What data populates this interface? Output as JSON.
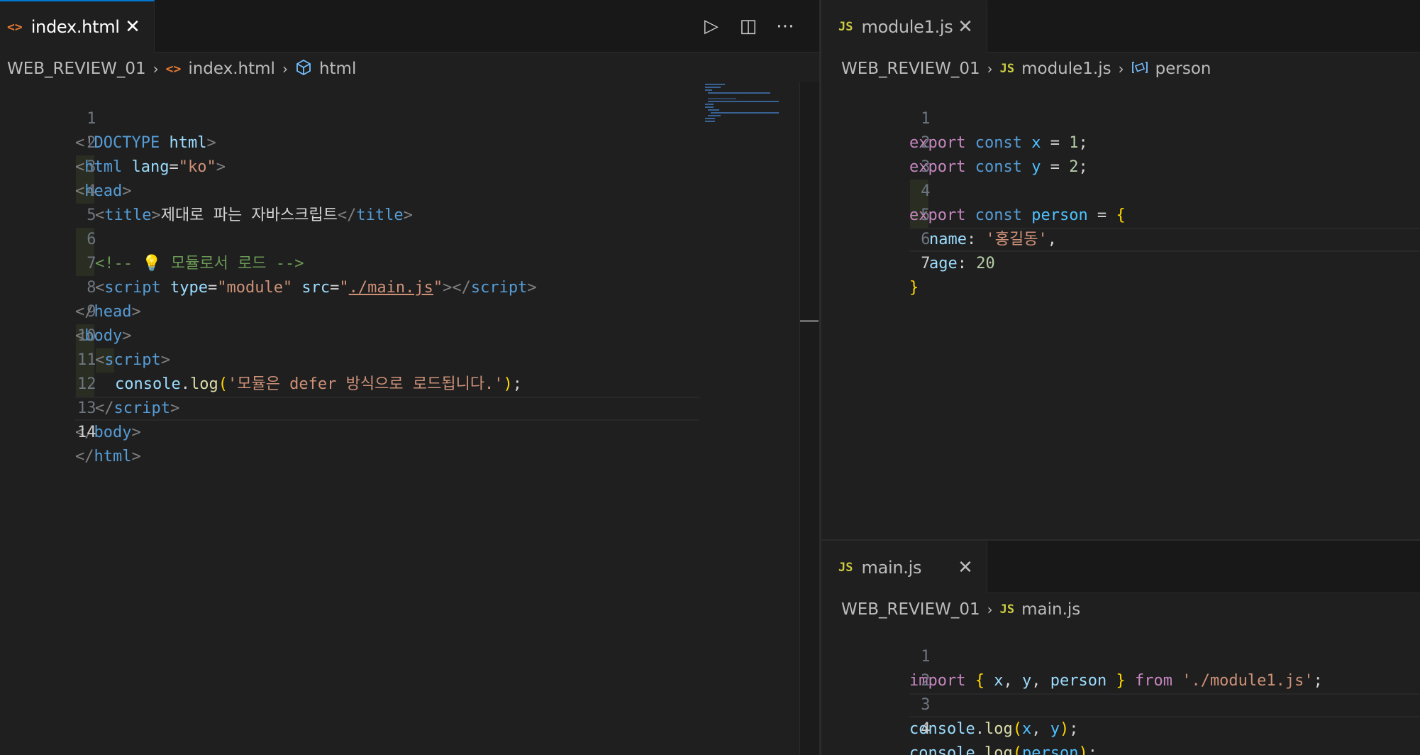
{
  "left_pane": {
    "tab": {
      "label": "index.html",
      "close": "✕",
      "icon": "html-file-icon"
    },
    "actions": {
      "run": "▷",
      "split": "◫",
      "more": "⋯"
    },
    "breadcrumb": {
      "root": "WEB_REVIEW_01",
      "file": "index.html",
      "symbol": "html",
      "sep": "›"
    },
    "line_numbers": [
      "1",
      "2",
      "3",
      "4",
      "5",
      "6",
      "7",
      "8",
      "9",
      "10",
      "11",
      "12",
      "13",
      "14"
    ],
    "code": {
      "l1": {
        "a": "<!",
        "b": "DOCTYPE",
        "c": " html",
        "d": ">"
      },
      "l2": {
        "a": "<",
        "b": "html",
        "c": " lang",
        "d": "=",
        "e": "\"ko\"",
        "f": ">"
      },
      "l3": {
        "a": "<",
        "b": "head",
        "c": ">"
      },
      "l4": {
        "a": "<",
        "b": "title",
        "c": ">",
        "d": "제대로 파는 자바스크립트",
        "e": "</",
        "f": "title",
        "g": ">"
      },
      "l6": {
        "a": "<!-- 💡 모듈로서 로드 -->"
      },
      "l7": {
        "a": "<",
        "b": "script",
        "c": " type",
        "d": "=",
        "e": "\"module\"",
        "f": " src",
        "g": "=",
        "h": "\"",
        "i": "./main.js",
        "j": "\"",
        "k": "></",
        "l": "script",
        "m": ">"
      },
      "l8": {
        "a": "</",
        "b": "head",
        "c": ">"
      },
      "l9": {
        "a": "<",
        "b": "body",
        "c": ">"
      },
      "l10": {
        "a": "<",
        "b": "script",
        "c": ">"
      },
      "l11": {
        "a": "console",
        "b": ".",
        "c": "log",
        "d": "(",
        "e": "'모듈은 defer 방식으로 로드됩니다.'",
        "f": ")",
        "g": ";"
      },
      "l12": {
        "a": "</",
        "b": "script",
        "c": ">"
      },
      "l13": {
        "a": "</",
        "b": "body",
        "c": ">"
      },
      "l14": {
        "a": "</",
        "b": "html",
        "c": ">"
      }
    }
  },
  "right_top_pane": {
    "tab": {
      "label": "module1.js",
      "close": "✕",
      "icon_text": "JS"
    },
    "breadcrumb": {
      "root": "WEB_REVIEW_01",
      "file": "module1.js",
      "symbol": "person",
      "sep": "›",
      "file_icon_text": "JS"
    },
    "line_numbers": [
      "1",
      "2",
      "3",
      "4",
      "5",
      "6",
      "7"
    ],
    "code": {
      "l1": {
        "a": "export",
        "b": " const",
        "c": " x",
        "d": " = ",
        "e": "1",
        "f": ";"
      },
      "l2": {
        "a": "export",
        "b": " const",
        "c": " y",
        "d": " = ",
        "e": "2",
        "f": ";"
      },
      "l4": {
        "a": "export",
        "b": " const",
        "c": " person",
        "d": " = ",
        "e": "{"
      },
      "l5": {
        "a": "name",
        "b": ": ",
        "c": "'홍길동'",
        "d": ","
      },
      "l6": {
        "a": "age",
        "b": ": ",
        "c": "20"
      },
      "l7": {
        "a": "}"
      }
    }
  },
  "right_bottom_pane": {
    "tab": {
      "label": "main.js",
      "close": "✕",
      "icon_text": "JS"
    },
    "breadcrumb": {
      "root": "WEB_REVIEW_01",
      "file": "main.js",
      "sep": "›",
      "file_icon_text": "JS"
    },
    "line_numbers": [
      "1",
      "2",
      "3",
      "4"
    ],
    "code": {
      "l1": {
        "a": "import",
        "b": " ",
        "c": "{",
        "d": " x",
        "e": ", ",
        "f": "y",
        "g": ", ",
        "h": "person",
        "i": " ",
        "j": "}",
        "k": " from",
        "l": " ",
        "m": "'./module1.js'",
        "n": ";"
      },
      "l3": {
        "a": "console",
        "b": ".",
        "c": "log",
        "d": "(",
        "e": "x",
        "f": ", ",
        "g": "y",
        "h": ")",
        "i": ";"
      },
      "l4": {
        "a": "console",
        "b": ".",
        "c": "log",
        "d": "(",
        "e": "person",
        "f": ")",
        "g": ";"
      }
    }
  },
  "colors": {
    "background": "#1f1f1f",
    "tab_accent": "#0078d4",
    "tag": "#569cd6",
    "string": "#ce9178",
    "keyword": "#c586c0"
  }
}
